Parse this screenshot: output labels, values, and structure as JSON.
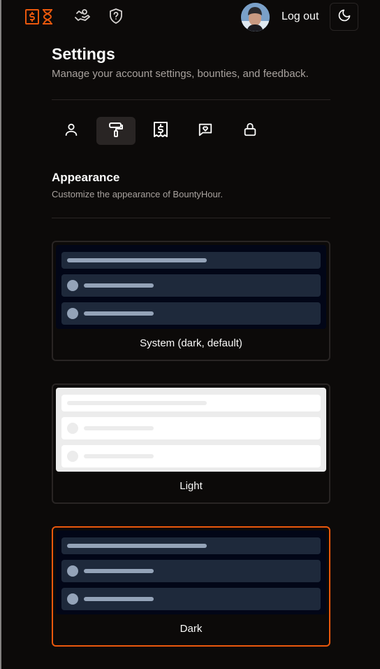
{
  "header": {
    "logout_label": "Log out",
    "icons": [
      "dollar-icon",
      "hourglass-icon",
      "hand-coin-icon",
      "shield-question-icon",
      "moon-icon"
    ],
    "accent_color": "#ea580c"
  },
  "page": {
    "title": "Settings",
    "subtitle": "Manage your account settings, bounties, and feedback."
  },
  "tabs": [
    {
      "icon": "user-icon",
      "active": false
    },
    {
      "icon": "paint-roller-icon",
      "active": true
    },
    {
      "icon": "receipt-icon",
      "active": false
    },
    {
      "icon": "message-heart-icon",
      "active": false
    },
    {
      "icon": "lock-icon",
      "active": false
    }
  ],
  "appearance": {
    "title": "Appearance",
    "description": "Customize the appearance of BountyHour.",
    "options": [
      {
        "label": "System (dark, default)",
        "selected": false
      },
      {
        "label": "Light",
        "selected": false
      },
      {
        "label": "Dark",
        "selected": true
      }
    ]
  }
}
